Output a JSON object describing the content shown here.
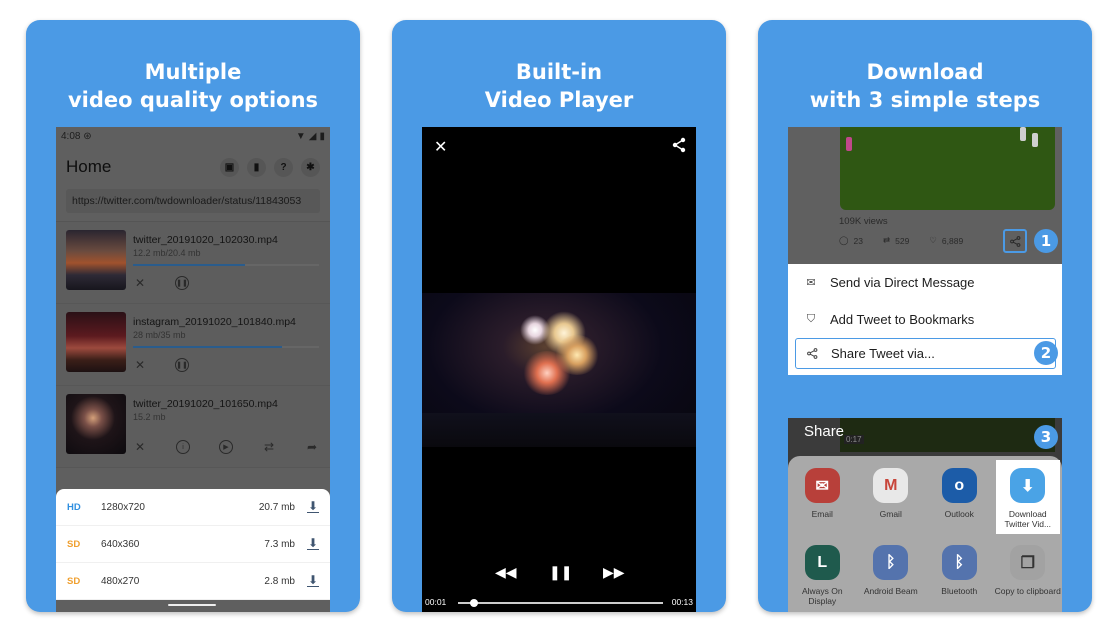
{
  "colors": {
    "card_bg": "#4b9ae5",
    "hd": "#2f8fe0",
    "sd": "#f0a030",
    "step": "#4b9ae5"
  },
  "cards": [
    {
      "title_line1": "Multiple",
      "title_line2": "video quality options"
    },
    {
      "title_line1": "Built-in",
      "title_line2": "Video Player"
    },
    {
      "title_line1": "Download",
      "title_line2": "with 3 simple steps"
    }
  ],
  "home": {
    "status_time": "4:08",
    "title": "Home",
    "icons": [
      "video-library-icon",
      "bookmark-icon",
      "help-icon",
      "settings-icon"
    ],
    "url": "https://twitter.com/twdownloader/status/11843053",
    "downloads": [
      {
        "name": "twitter_20191020_102030.mp4",
        "size": "12.2 mb/20.4 mb",
        "progress": 0.6
      },
      {
        "name": "instagram_20191020_101840.mp4",
        "size": "28 mb/35 mb",
        "progress": 0.8
      },
      {
        "name": "twitter_20191020_101650.mp4",
        "size": "15.2 mb"
      }
    ],
    "qualities": [
      {
        "badge": "HD",
        "resolution": "1280x720",
        "size": "20.7 mb"
      },
      {
        "badge": "SD",
        "resolution": "640x360",
        "size": "7.3 mb"
      },
      {
        "badge": "SD",
        "resolution": "480x270",
        "size": "2.8 mb"
      }
    ]
  },
  "player": {
    "current_time": "00:01",
    "total_time": "00:13",
    "progress": 0.077
  },
  "steps": {
    "views": "109K views",
    "replies": "23",
    "retweets": "529",
    "likes": "6,889",
    "badges": [
      "1",
      "2",
      "3"
    ],
    "menu": [
      "Send via Direct Message",
      "Add Tweet to Bookmarks",
      "Share Tweet via..."
    ],
    "share_title": "Share",
    "video_duration": "0:17",
    "apps": [
      {
        "label": "Email",
        "icon": "email-icon",
        "color": "#b8403a",
        "glyph": "✉"
      },
      {
        "label": "Gmail",
        "icon": "gmail-icon",
        "color": "#e8e8e8",
        "glyph": "M"
      },
      {
        "label": "Outlook",
        "icon": "outlook-icon",
        "color": "#1c5ca8",
        "glyph": "o"
      },
      {
        "label": "Download Twitter Vid...",
        "icon": "download-app-icon",
        "color": "#4aa3e6",
        "glyph": "⬇"
      },
      {
        "label": "Always On Display",
        "icon": "clock-icon",
        "color": "#1f5a4d",
        "glyph": "L"
      },
      {
        "label": "Android Beam",
        "icon": "android-beam-icon",
        "color": "#5473ad",
        "glyph": "ᛒ"
      },
      {
        "label": "Bluetooth",
        "icon": "bluetooth-icon",
        "color": "#5473ad",
        "glyph": "ᛒ"
      },
      {
        "label": "Copy to clipboard",
        "icon": "copy-icon",
        "color": "#a2a2a2",
        "glyph": "❐"
      }
    ]
  }
}
